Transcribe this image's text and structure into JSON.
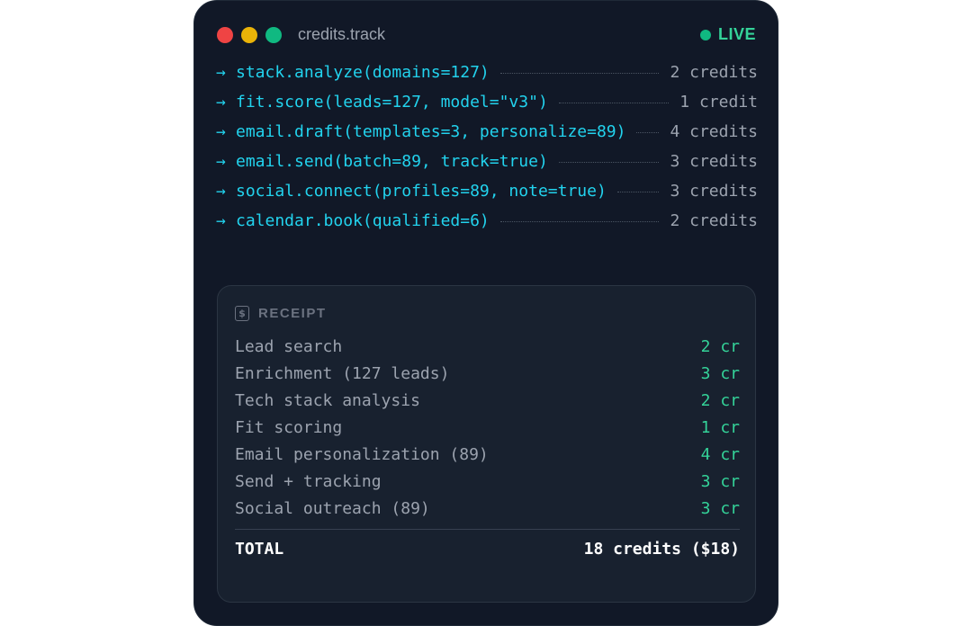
{
  "window": {
    "title": "credits.track",
    "status": "LIVE",
    "colors": {
      "background": "#111827",
      "cyan": "#22d3ee",
      "green": "#34d399",
      "muted": "#9ca3af"
    }
  },
  "calls": [
    {
      "arrow": "→",
      "fn": "stack.analyze(domains=127)",
      "cost": "2 credits"
    },
    {
      "arrow": "→",
      "fn": "fit.score(leads=127, model=\"v3\")",
      "cost": "1 credit"
    },
    {
      "arrow": "→",
      "fn": "email.draft(templates=3, personalize=89)",
      "cost": "4 credits"
    },
    {
      "arrow": "→",
      "fn": "email.send(batch=89, track=true)",
      "cost": "3 credits"
    },
    {
      "arrow": "→",
      "fn": "social.connect(profiles=89, note=true)",
      "cost": "3 credits"
    },
    {
      "arrow": "→",
      "fn": "calendar.book(qualified=6)",
      "cost": "2 credits"
    }
  ],
  "receipt": {
    "heading": "RECEIPT",
    "icon": "receipt-dollar-icon",
    "items": [
      {
        "label": "Lead search",
        "value": "2 cr"
      },
      {
        "label": "Enrichment (127 leads)",
        "value": "3 cr"
      },
      {
        "label": "Tech stack analysis",
        "value": "2 cr"
      },
      {
        "label": "Fit scoring",
        "value": "1 cr"
      },
      {
        "label": "Email personalization (89)",
        "value": "4 cr"
      },
      {
        "label": "Send + tracking",
        "value": "3 cr"
      },
      {
        "label": "Social outreach (89)",
        "value": "3 cr"
      }
    ],
    "total_label": "TOTAL",
    "total_value": "18 credits ($18)"
  }
}
